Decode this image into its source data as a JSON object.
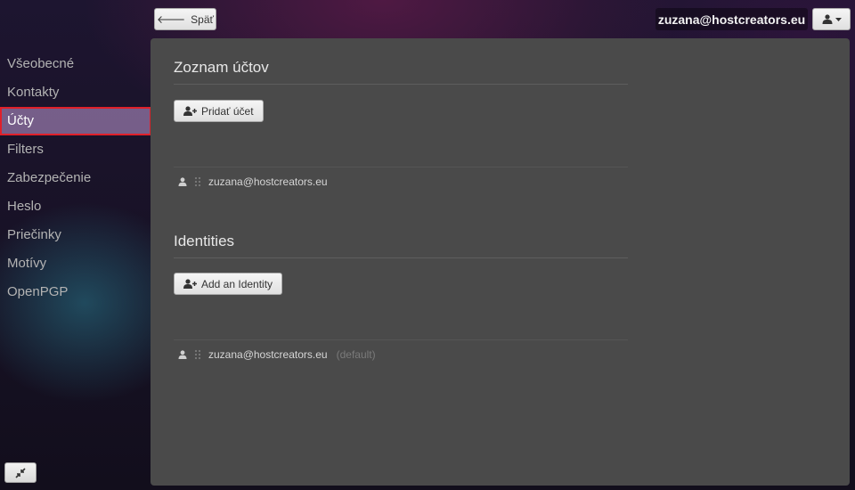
{
  "header": {
    "back_label": "Späť",
    "account_email": "zuzana@hostcreators.eu"
  },
  "sidebar": {
    "items": [
      {
        "label": "Všeobecné"
      },
      {
        "label": "Kontakty"
      },
      {
        "label": "Účty"
      },
      {
        "label": "Filters"
      },
      {
        "label": "Zabezpečenie"
      },
      {
        "label": "Heslo"
      },
      {
        "label": "Priečinky"
      },
      {
        "label": "Motívy"
      },
      {
        "label": "OpenPGP"
      }
    ],
    "active_item": "Účty"
  },
  "accounts": {
    "title": "Zoznam účtov",
    "add_label": "Pridať účet",
    "list": [
      {
        "email": "zuzana@hostcreators.eu"
      }
    ]
  },
  "identities": {
    "title": "Identities",
    "add_label": "Add an Identity",
    "list": [
      {
        "email": "zuzana@hostcreators.eu",
        "tag": "(default)"
      }
    ]
  },
  "colors": {
    "active_highlight": "#9678aa",
    "active_border": "#e0202a",
    "panel_bg": "#4a4a4a"
  },
  "icons": [
    "arrow-left-icon",
    "user-icon",
    "caret-down-icon",
    "add-user-icon",
    "drag-handle-icon",
    "collapse-icon"
  ]
}
